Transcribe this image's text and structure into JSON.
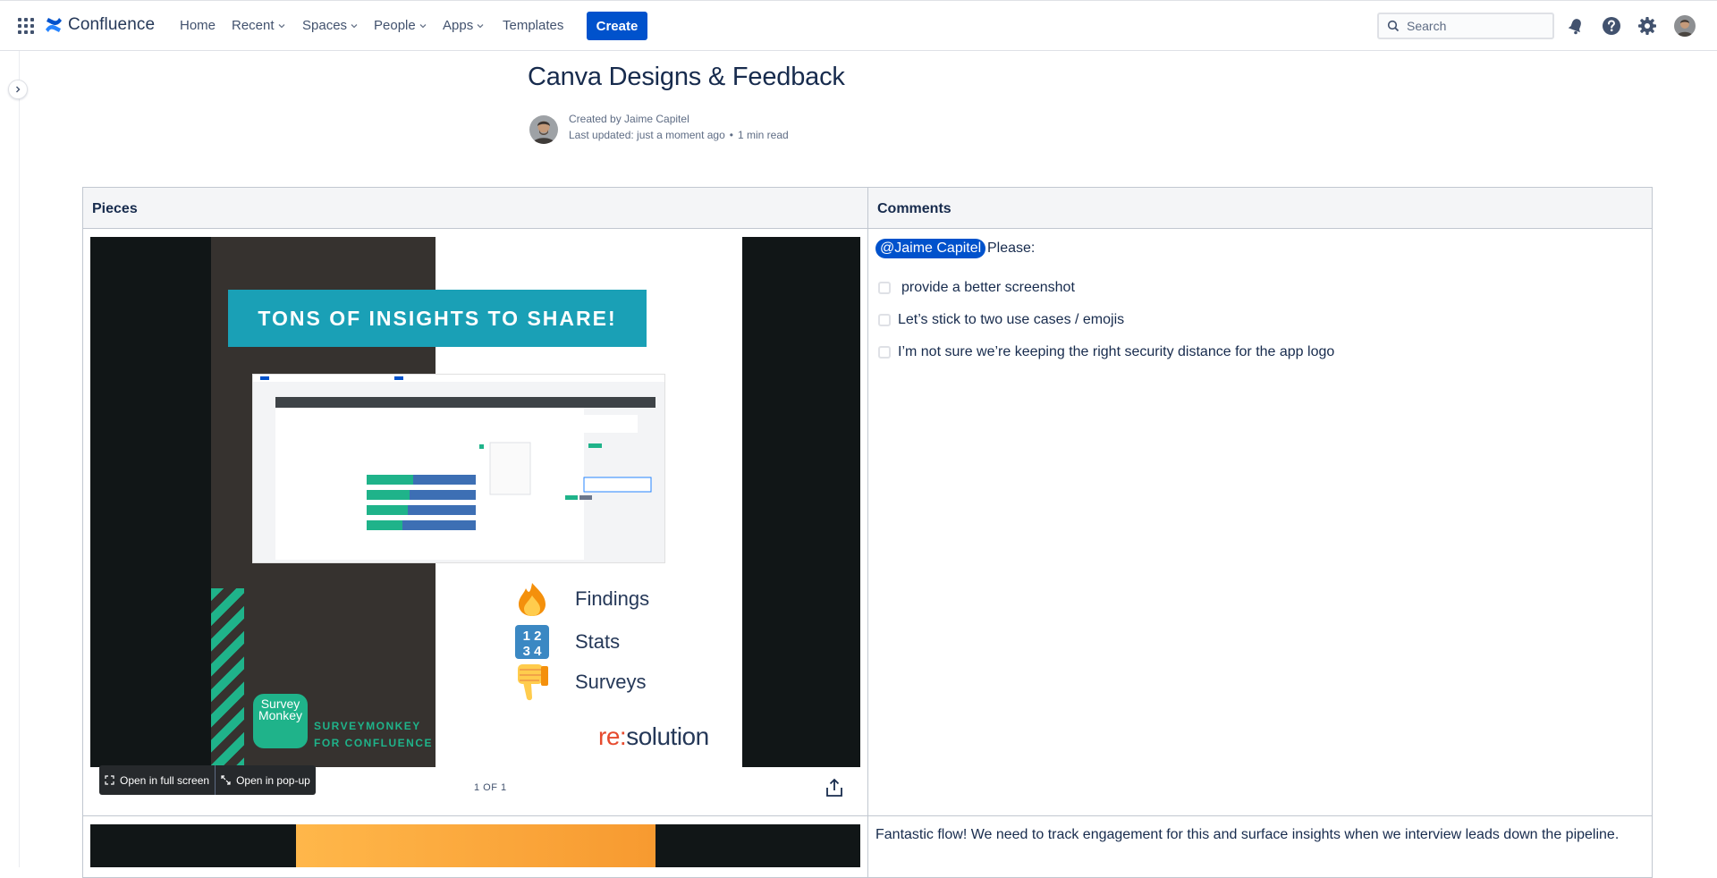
{
  "nav": {
    "product_name": "Confluence",
    "items": [
      {
        "label": "Home",
        "has_dropdown": false
      },
      {
        "label": "Recent",
        "has_dropdown": true
      },
      {
        "label": "Spaces",
        "has_dropdown": true
      },
      {
        "label": "People",
        "has_dropdown": true
      },
      {
        "label": "Apps",
        "has_dropdown": true
      },
      {
        "label": "Templates",
        "has_dropdown": false
      }
    ],
    "create_label": "Create",
    "search_placeholder": "Search",
    "icons": [
      "notifications-icon",
      "help-icon",
      "settings-icon",
      "profile-avatar"
    ]
  },
  "page": {
    "title": "Canva Designs & Feedback",
    "created_by": "Created by Jaime Capitel",
    "last_updated": "Last updated: just a moment ago",
    "bullet": "•",
    "read_time": "1 min read"
  },
  "table": {
    "headers": {
      "pieces": "Pieces",
      "comments": "Comments"
    },
    "rows": [
      {
        "embed": {
          "banner": "TONS OF INSIGHTS TO SHARE!",
          "features": [
            "Findings",
            "Stats",
            "Surveys"
          ],
          "app_logo_text": "Survey Monkey",
          "caption_line1": "SURVEYMONKEY",
          "caption_line2": "FOR CONFLUENCE",
          "brand_prefix": "re:",
          "brand_suffix": "solution",
          "open_full_screen": "Open in full screen",
          "open_popup": "Open in pop-up",
          "page_count": "1 OF 1"
        },
        "comment": {
          "mention": "@Jaime Capitel",
          "text": "Please:",
          "tasks": [
            {
              "label": "provide a better screenshot",
              "checked": false
            },
            {
              "label": "Let’s stick to two use cases / emojis",
              "checked": false
            },
            {
              "label": "I’m not sure we’re keeping the right security distance for the app logo",
              "checked": false
            }
          ]
        }
      },
      {
        "comment": {
          "text": "Fantastic flow! We need to track engagement for this and surface insights when we interview leads down the pipeline."
        }
      }
    ]
  },
  "colors": {
    "accent": "#0052cc",
    "banner": "#1aa0b6",
    "surveymonkey_green": "#1fb38a",
    "brand_red": "#e64a2e"
  }
}
